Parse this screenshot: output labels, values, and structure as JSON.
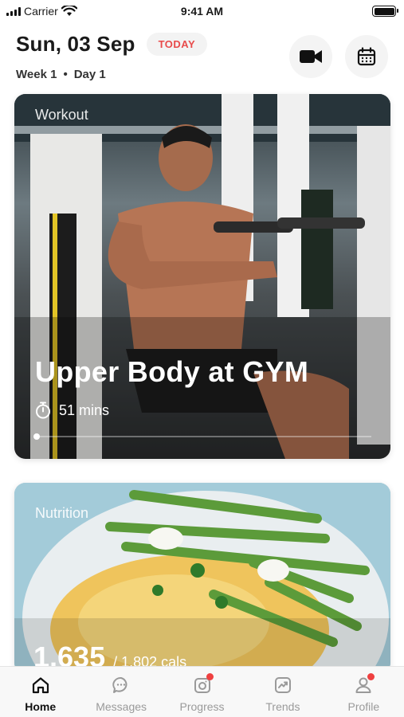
{
  "status_bar": {
    "carrier": "Carrier",
    "time": "9:41 AM"
  },
  "header": {
    "date": "Sun, 03 Sep",
    "today_badge": "TODAY",
    "week": "Week 1",
    "separator": "•",
    "day": "Day 1"
  },
  "workout_card": {
    "label": "Workout",
    "title": "Upper Body at GYM",
    "duration": "51 mins",
    "progress": 0.0
  },
  "nutrition_card": {
    "label": "Nutrition",
    "calories": "1,635",
    "calories_goal": "/ 1,802 cals"
  },
  "tabs": [
    {
      "label": "Home",
      "icon": "home-icon",
      "active": true
    },
    {
      "label": "Messages",
      "icon": "chat-bubble-icon"
    },
    {
      "label": "Progress",
      "icon": "camera-icon",
      "notification": true
    },
    {
      "label": "Trends",
      "icon": "trend-chart-icon"
    },
    {
      "label": "Profile",
      "icon": "user-icon",
      "notification": true
    }
  ],
  "colors": {
    "accent_red": "#e84b4b",
    "notification": "#ef4040"
  }
}
